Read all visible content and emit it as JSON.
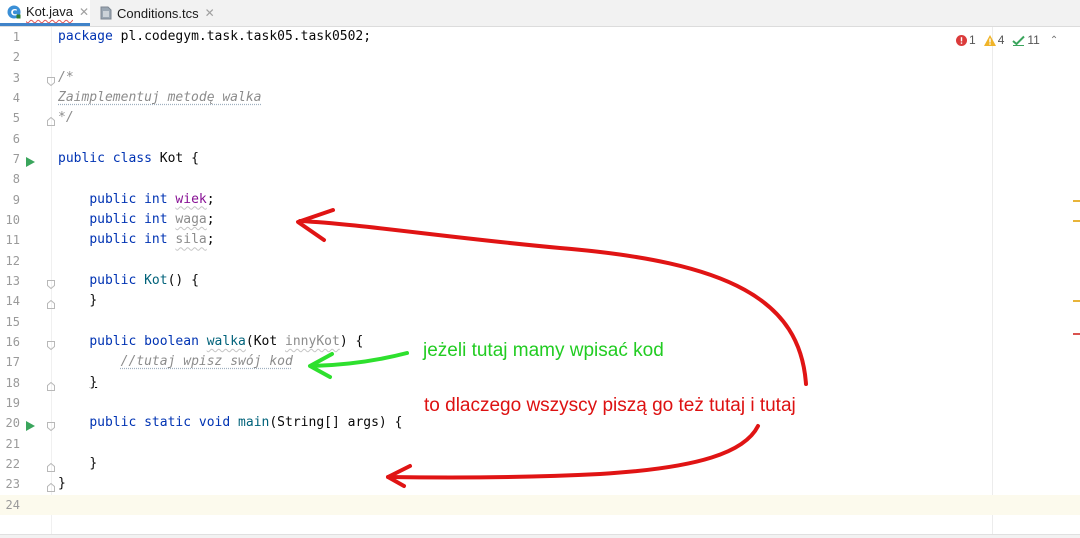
{
  "tabs": [
    {
      "label": "Kot.java",
      "icon": "java-class-icon",
      "active": true
    },
    {
      "label": "Conditions.tcs",
      "icon": "file-icon",
      "active": false
    }
  ],
  "inspection": {
    "errors": "1",
    "warnings": "4",
    "ok": "11"
  },
  "lines": [
    {
      "n": "1"
    },
    {
      "n": "2"
    },
    {
      "n": "3"
    },
    {
      "n": "4"
    },
    {
      "n": "5"
    },
    {
      "n": "6"
    },
    {
      "n": "7"
    },
    {
      "n": "8"
    },
    {
      "n": "9"
    },
    {
      "n": "10"
    },
    {
      "n": "11"
    },
    {
      "n": "12"
    },
    {
      "n": "13"
    },
    {
      "n": "14"
    },
    {
      "n": "15"
    },
    {
      "n": "16"
    },
    {
      "n": "17"
    },
    {
      "n": "18"
    },
    {
      "n": "19"
    },
    {
      "n": "20"
    },
    {
      "n": "21"
    },
    {
      "n": "22"
    },
    {
      "n": "23"
    },
    {
      "n": "24"
    }
  ],
  "code": {
    "l1": {
      "kw": "package",
      "rest": " pl.codegym.task.task05.task0502;"
    },
    "l3": "/*",
    "l4": "Zaimplementuj metodę walka",
    "l5": "*/",
    "l7": {
      "kw1": "public",
      "kw2": "class",
      "rest": " Kot {"
    },
    "l9": {
      "kw1": "public",
      "kw2": "int",
      "field": "wiek",
      "end": ";"
    },
    "l10": {
      "kw1": "public",
      "kw2": "int",
      "field": "waga",
      "end": ";"
    },
    "l11": {
      "kw1": "public",
      "kw2": "int",
      "field": "sila",
      "end": ";"
    },
    "l13": {
      "kw1": "public",
      "method": "Kot",
      "rest": "() {"
    },
    "l14": "}",
    "l16": {
      "kw1": "public",
      "kw2": "boolean",
      "method": "walka",
      "p1": "(Kot ",
      "param": "innyKot",
      "p2": ") {"
    },
    "l17": "//tutaj wpisz swój kod",
    "l18": "}",
    "l20": {
      "kw1": "public",
      "kw2": "static",
      "kw3": "void",
      "method": "main",
      "rest": "(String[] args) {"
    },
    "l22": "}",
    "l23": "}"
  },
  "annotations": {
    "green_text": "jeżeli tutaj mamy wpisać kod",
    "red_text": "to dlaczego wszyscy piszą go też tutaj i tutaj"
  },
  "colors": {
    "keyword": "#0033b3",
    "field": "#871094",
    "method": "#00627a",
    "comment": "#8c8c8c",
    "annotation_green": "#22cc22",
    "annotation_red": "#dd1111"
  }
}
